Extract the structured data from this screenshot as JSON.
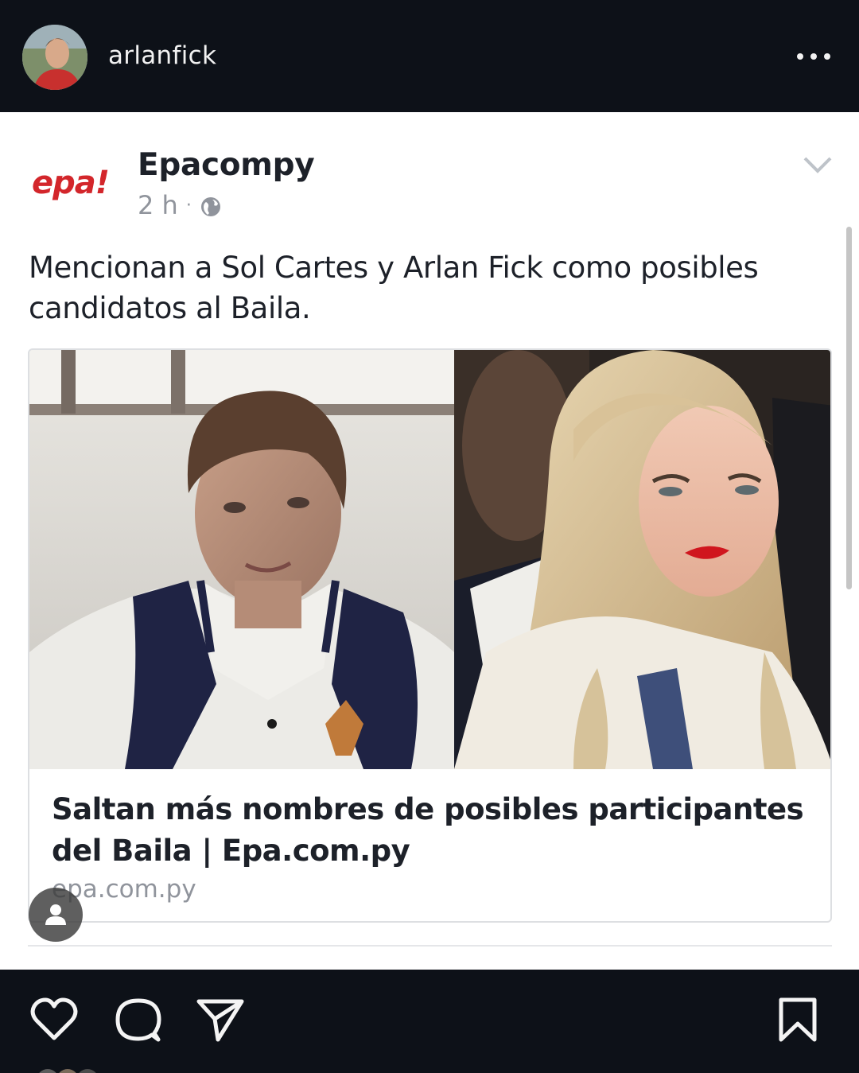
{
  "instagram": {
    "username": "arlanfick",
    "actions": {
      "like_icon": "heart-outline-icon",
      "comment_icon": "comment-bubble-icon",
      "share_icon": "paper-plane-icon",
      "save_icon": "bookmark-outline-icon"
    }
  },
  "facebook_post": {
    "logo_text": "epa!",
    "page_name": "Epacompy",
    "time": "2 h",
    "separator": "·",
    "post_text": "Mencionan a Sol Cartes y Arlan Fick como posibles candidatos al Baila.",
    "link_card": {
      "title": "Saltan más nombres de posibles participantes del Baila | Epa.com.py",
      "domain": "epa.com.py"
    }
  },
  "colors": {
    "background_dark": "#0d1118",
    "epa_red": "#d3262b",
    "facebook_text": "#1d2129",
    "facebook_meta": "#90949c"
  }
}
